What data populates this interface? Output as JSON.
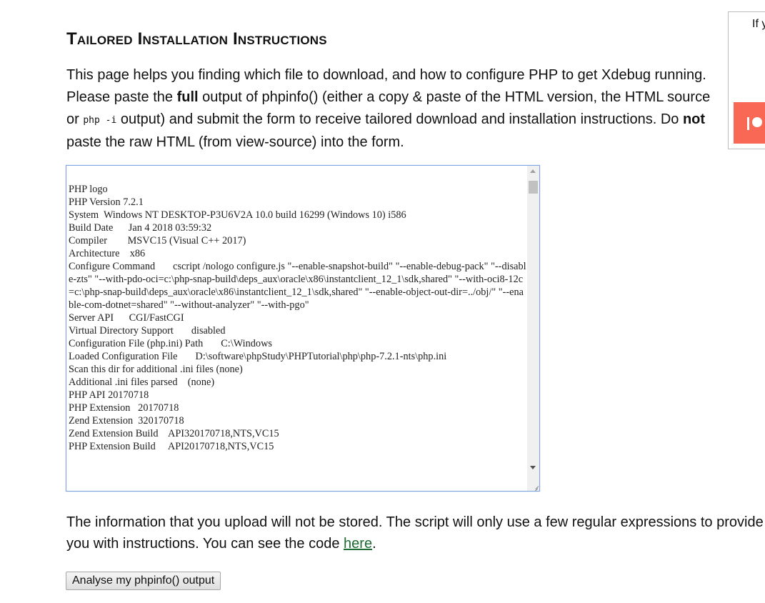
{
  "header": {
    "title": "Tailored Installation Instructions"
  },
  "intro": {
    "part1": "This page helps you finding which file to download, and how to configure PHP to get Xdebug running. Please paste the ",
    "bold1": "full",
    "part2": " output of phpinfo() (either a copy & paste of the HTML version, the HTML source or ",
    "code": "php -i",
    "part3": " output) and submit the form to receive tailored download and installation instructions. Do ",
    "bold2": "not",
    "part4": " paste the raw HTML (from view-source) into the form."
  },
  "phpinfo_textarea": {
    "value": "PHP logo\nPHP Version 7.2.1\nSystem  Windows NT DESKTOP-P3U6V2A 10.0 build 16299 (Windows 10) i586\nBuild Date      Jan 4 2018 03:59:32\nCompiler        MSVC15 (Visual C++ 2017)\nArchitecture    x86\nConfigure Command       cscript /nologo configure.js \"--enable-snapshot-build\" \"--enable-debug-pack\" \"--disable-zts\" \"--with-pdo-oci=c:\\php-snap-build\\deps_aux\\oracle\\x86\\instantclient_12_1\\sdk,shared\" \"--with-oci8-12c=c:\\php-snap-build\\deps_aux\\oracle\\x86\\instantclient_12_1\\sdk,shared\" \"--enable-object-out-dir=../obj/\" \"--enable-com-dotnet=shared\" \"--without-analyzer\" \"--with-pgo\"\nServer API      CGI/FastCGI\nVirtual Directory Support       disabled\nConfiguration File (php.ini) Path       C:\\Windows\nLoaded Configuration File       D:\\software\\phpStudy\\PHPTutorial\\php\\php-7.2.1-nts\\php.ini\nScan this dir for additional .ini files (none)\nAdditional .ini files parsed    (none)\nPHP API 20170718\nPHP Extension   20170718\nZend Extension  320170718\nZend Extension Build    API320170718,NTS,VC15\nPHP Extension Build     API20170718,NTS,VC15"
  },
  "notice": {
    "text_before_link": "The information that you upload will not be stored. The script will only use a few regular expressions to provide you with instructions. You can see the code ",
    "link_label": "here",
    "text_after_link": "."
  },
  "form": {
    "submit_label": "Analyse my phpinfo() output"
  },
  "sidebar": {
    "text": "If y"
  },
  "colors": {
    "link": "#1d6b33",
    "patreon": "#f96854",
    "textarea_border": "#7da4e0"
  },
  "icons": {
    "patreon": "patreon-icon"
  }
}
